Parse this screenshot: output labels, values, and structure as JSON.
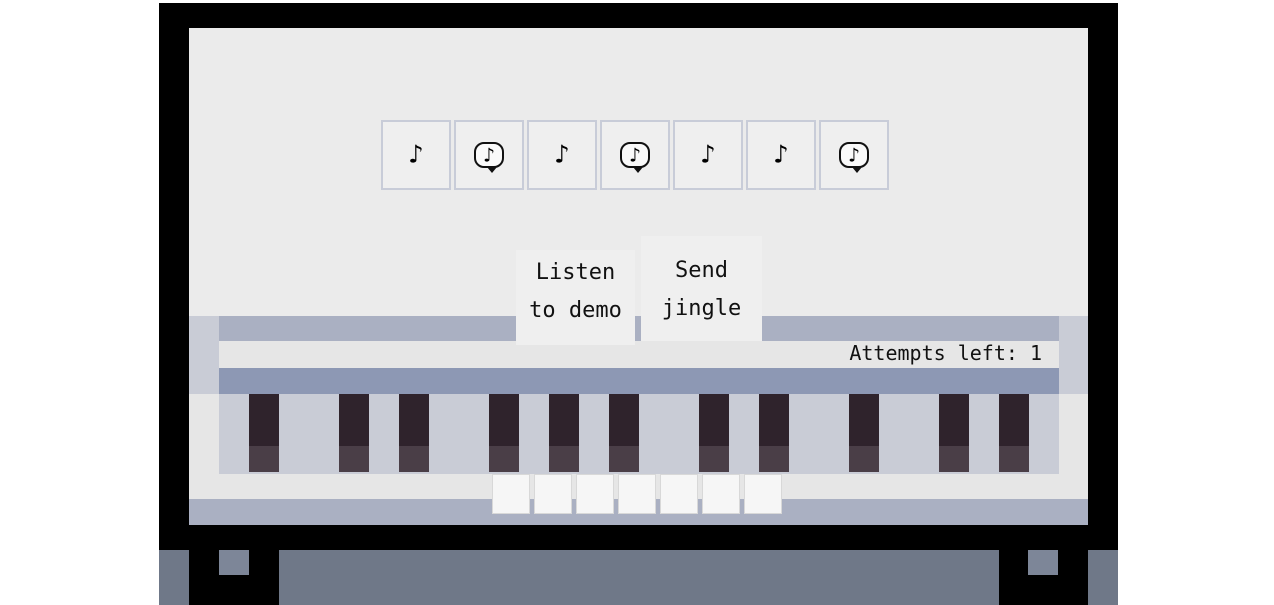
{
  "jingle_slots": [
    {
      "type": "note",
      "glyph": "♪"
    },
    {
      "type": "bubble",
      "glyph": "♪"
    },
    {
      "type": "note",
      "glyph": "♪"
    },
    {
      "type": "bubble",
      "glyph": "♪"
    },
    {
      "type": "note",
      "glyph": "♪"
    },
    {
      "type": "note",
      "glyph": "♪"
    },
    {
      "type": "bubble",
      "glyph": "♪"
    }
  ],
  "buttons": {
    "listen_line1": "Listen",
    "listen_line2": "to demo",
    "send_line1": "Send",
    "send_line2": "jingle"
  },
  "status": {
    "attempts": "Attempts left: 1"
  },
  "icons": {
    "note": "music-note-icon",
    "bubble": "speech-bubble-note-icon"
  },
  "colors": {
    "frame": "#000000",
    "screen": "#ebebeb",
    "black_key": "#2f232c",
    "accent_band": "#8d98b4"
  }
}
